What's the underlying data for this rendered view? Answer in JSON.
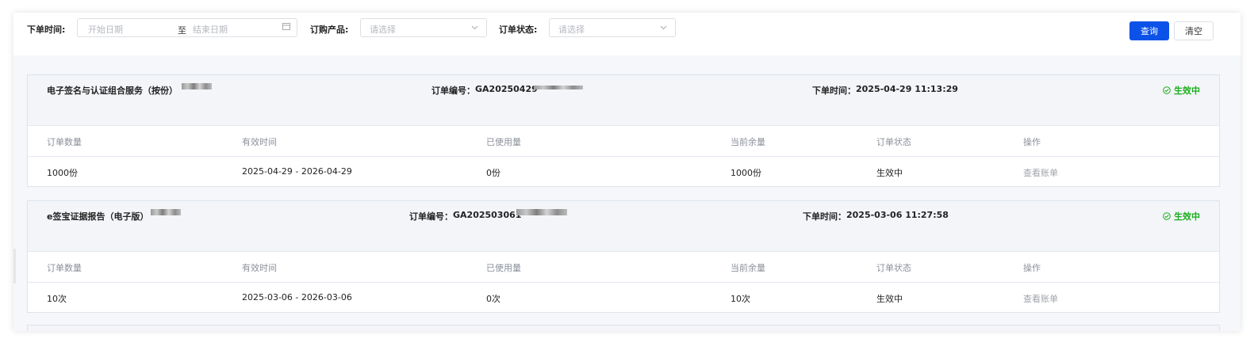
{
  "filters": {
    "order_time_label": "下单时间:",
    "start_date_placeholder": "开始日期",
    "range_separator": "至",
    "end_date_placeholder": "结束日期",
    "product_label": "订购产品:",
    "product_placeholder": "请选择",
    "status_label": "订单状态:",
    "status_placeholder": "请选择"
  },
  "buttons": {
    "query": "查询",
    "clear": "清空"
  },
  "table_headers": [
    "订单数量",
    "有效时间",
    "已使用量",
    "当前余量",
    "订单状态",
    "操作"
  ],
  "orders": [
    {
      "product": "电子签名与认证组合服务（按份）",
      "order_no_label": "订单编号：",
      "order_no": "GA20250429",
      "order_time_label": "下单时间：",
      "order_time": "2025-04-29 11:13:29",
      "status": "生效中",
      "row": {
        "quantity": "1000份",
        "valid_period": "2025-04-29 - 2026-04-29",
        "used": "0份",
        "remaining": "1000份",
        "status": "生效中",
        "action": "查看账单"
      }
    },
    {
      "product": "e签宝证据报告（电子版）",
      "order_no_label": "订单编号：",
      "order_no": "GA202503061",
      "order_time_label": "下单时间：",
      "order_time": "2025-03-06 11:27:58",
      "status": "生效中",
      "row": {
        "quantity": "10次",
        "valid_period": "2025-03-06 - 2026-03-06",
        "used": "0次",
        "remaining": "10次",
        "status": "生效中",
        "action": "查看账单"
      }
    }
  ],
  "icons": {
    "calendar": "calendar-icon",
    "dropdown": "chevron-down-icon",
    "active": "check-circle-icon"
  },
  "colors": {
    "primary": "#0c52e8",
    "active_green": "#1aad19"
  }
}
